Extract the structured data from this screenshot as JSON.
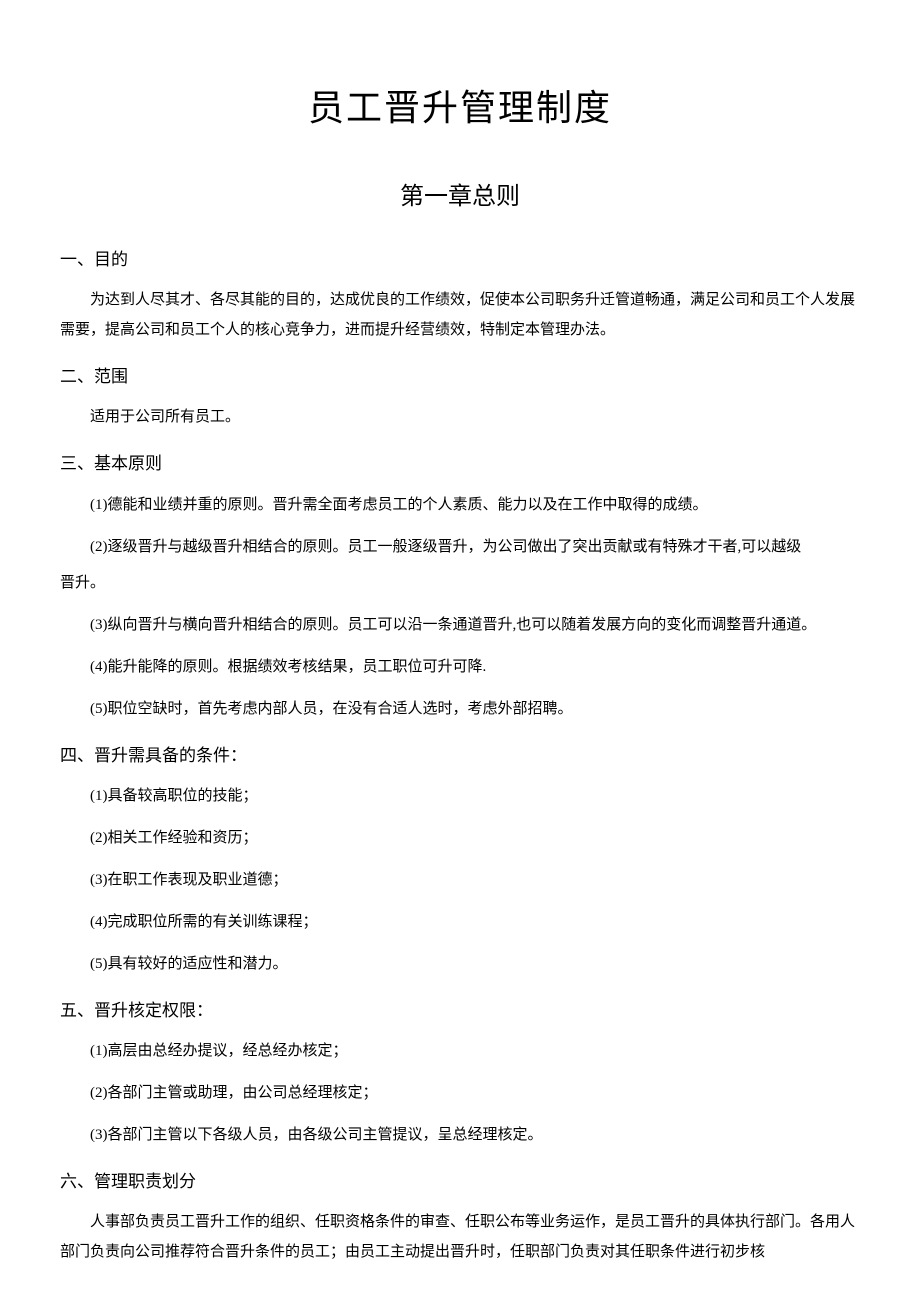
{
  "title": "员工晋升管理制度",
  "chapter": "第一章总则",
  "sections": {
    "s1": {
      "heading": "一、目的",
      "body": "为达到人尽其才、各尽其能的目的，达成优良的工作绩效，促使本公司职务升迁管道畅通，满足公司和员工个人发展需要，提高公司和员工个人的核心竞争力，进而提升经营绩效，特制定本管理办法。"
    },
    "s2": {
      "heading": "二、范围",
      "body": "适用于公司所有员工。"
    },
    "s3": {
      "heading": "三、基本原则",
      "items": {
        "i1": "(1)德能和业绩并重的原则。晋升需全面考虑员工的个人素质、能力以及在工作中取得的成绩。",
        "i2a": "(2)逐级晋升与越级晋升相结合的原则。员工一般逐级晋升，为公司做出了突出贡献或有特殊才干者,可以越级",
        "i2b": "晋升。",
        "i3": "(3)纵向晋升与横向晋升相结合的原则。员工可以沿一条通道晋升,也可以随着发展方向的变化而调整晋升通道。",
        "i4": "(4)能升能降的原则。根据绩效考核结果，员工职位可升可降.",
        "i5": "(5)职位空缺时，首先考虑内部人员，在没有合适人选时，考虑外部招聘。"
      }
    },
    "s4": {
      "heading": "四、晋升需具备的条件：",
      "items": {
        "i1": "(1)具备较高职位的技能；",
        "i2": "(2)相关工作经验和资历；",
        "i3": "(3)在职工作表现及职业道德；",
        "i4": "(4)完成职位所需的有关训练课程；",
        "i5": "(5)具有较好的适应性和潜力。"
      }
    },
    "s5": {
      "heading": "五、晋升核定权限：",
      "items": {
        "i1": "(1)高层由总经办提议，经总经办核定；",
        "i2": "(2)各部门主管或助理，由公司总经理核定；",
        "i3": "(3)各部门主管以下各级人员，由各级公司主管提议，呈总经理核定。"
      }
    },
    "s6": {
      "heading": "六、管理职责划分",
      "body": "人事部负责员工晋升工作的组织、任职资格条件的审查、任职公布等业务运作，是员工晋升的具体执行部门。各用人部门负责向公司推荐符合晋升条件的员工；由员工主动提出晋升时，任职部门负责对其任职条件进行初步核"
    }
  }
}
